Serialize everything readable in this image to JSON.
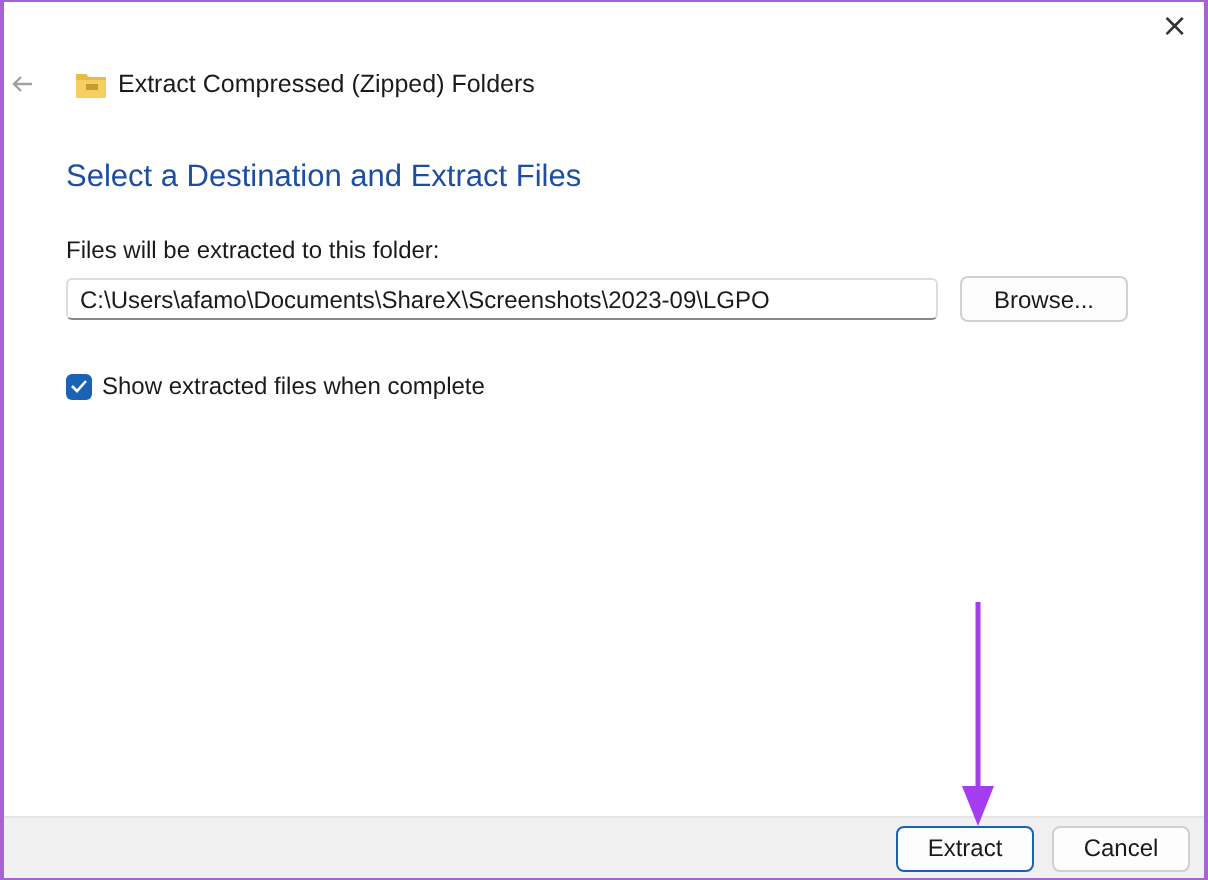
{
  "window": {
    "title": "Extract Compressed (Zipped) Folders",
    "close": "×"
  },
  "heading": "Select a Destination and Extract Files",
  "destination": {
    "label": "Files will be extracted to this folder:",
    "value": "C:\\Users\\afamo\\Documents\\ShareX\\Screenshots\\2023-09\\LGPO",
    "browse": "Browse..."
  },
  "show_files": {
    "label": "Show extracted files when complete",
    "checked": true
  },
  "buttons": [
    {
      "label": "Extract",
      "default": true
    },
    {
      "label": "Cancel",
      "default": false
    }
  ]
}
